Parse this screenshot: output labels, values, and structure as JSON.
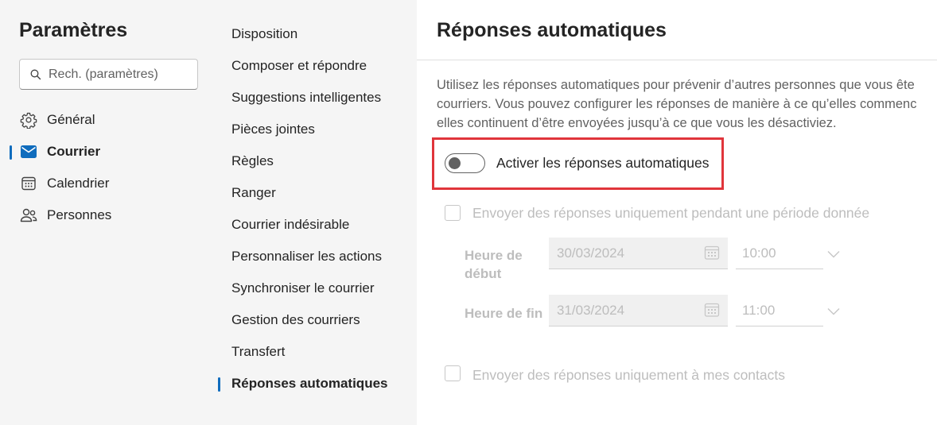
{
  "app": {
    "title": "Paramètres"
  },
  "search": {
    "placeholder": "Rech. (paramètres)"
  },
  "nav": [
    {
      "label": "Général",
      "icon": "gear-icon"
    },
    {
      "label": "Courrier",
      "icon": "mail-icon",
      "active": true
    },
    {
      "label": "Calendrier",
      "icon": "calendar-icon"
    },
    {
      "label": "Personnes",
      "icon": "people-icon"
    }
  ],
  "subnav": [
    {
      "label": "Disposition"
    },
    {
      "label": "Composer et répondre"
    },
    {
      "label": "Suggestions intelligentes"
    },
    {
      "label": "Pièces jointes"
    },
    {
      "label": "Règles"
    },
    {
      "label": "Ranger"
    },
    {
      "label": "Courrier indésirable"
    },
    {
      "label": "Personnaliser les actions"
    },
    {
      "label": "Synchroniser le courrier"
    },
    {
      "label": "Gestion des courriers"
    },
    {
      "label": "Transfert"
    },
    {
      "label": "Réponses automatiques",
      "active": true
    }
  ],
  "panel": {
    "title": "Réponses automatiques",
    "description": [
      "Utilisez les réponses automatiques pour prévenir d’autres personnes que vous ête",
      "courriers. Vous pouvez configurer les réponses de manière à ce qu’elles commenc",
      "elles continuent d’être envoyées jusqu’à ce que vous les désactiviez."
    ],
    "toggle": {
      "label": "Activer les réponses automatiques",
      "on": false
    },
    "period_checkbox": {
      "label": "Envoyer des réponses uniquement pendant une période donnée",
      "checked": false
    },
    "start": {
      "label_line1": "Heure de",
      "label_line2": "début",
      "date": "30/03/2024",
      "time": "10:00"
    },
    "end": {
      "label": "Heure de fin",
      "date": "31/03/2024",
      "time": "11:00"
    },
    "contacts_checkbox": {
      "label": "Envoyer des réponses uniquement à mes contacts",
      "checked": false
    }
  },
  "colors": {
    "accent": "#0f6cbd",
    "highlight": "#e0353b",
    "disabled": "#bdbdbd"
  }
}
